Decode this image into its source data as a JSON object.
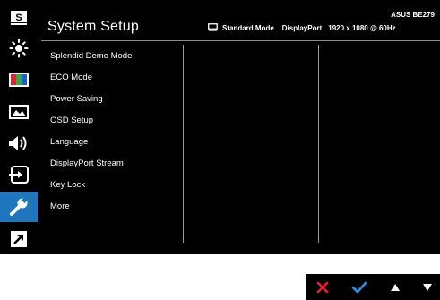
{
  "osd": {
    "title": "System Setup",
    "model": "ASUS BE279",
    "status": {
      "mode": "Standard Mode",
      "input": "DisplayPort",
      "resolution": "1920 x 1080 @ 60Hz"
    },
    "side_icons": [
      {
        "name": "splendid-icon",
        "glyph": "S"
      },
      {
        "name": "brightness-icon"
      },
      {
        "name": "color-icon"
      },
      {
        "name": "image-icon"
      },
      {
        "name": "sound-icon"
      },
      {
        "name": "input-select-icon"
      },
      {
        "name": "system-setup-icon",
        "active": true
      },
      {
        "name": "shortcut-icon"
      }
    ],
    "menu": [
      "Splendid Demo Mode",
      "ECO Mode",
      "Power Saving",
      "OSD Setup",
      "Language",
      "DisplayPort Stream",
      "Key Lock",
      "More"
    ]
  },
  "colors": {
    "accent": "#1f76bd",
    "background": "#000000",
    "close_key": "#e8212b",
    "confirm_key": "#2b8fe0"
  },
  "keys": [
    {
      "name": "close-key-icon"
    },
    {
      "name": "confirm-key-icon"
    },
    {
      "name": "up-key-icon"
    },
    {
      "name": "down-key-icon"
    }
  ]
}
